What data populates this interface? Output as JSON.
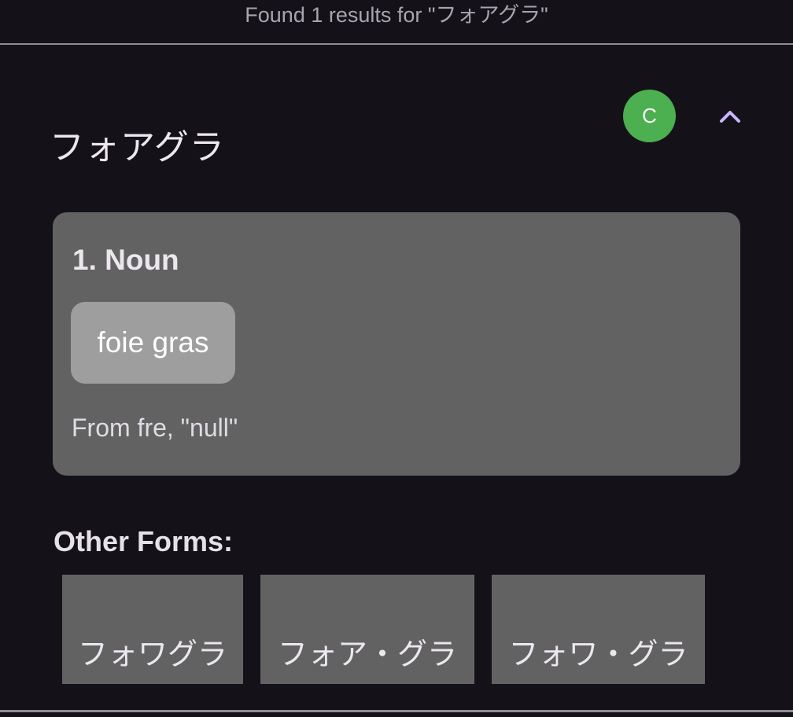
{
  "header": {
    "results_text": "Found 1 results for \"フォアグラ\""
  },
  "entry": {
    "title": "フォアグラ",
    "avatar_letter": "C",
    "collapse_icon": "chevron-up-icon",
    "senses": [
      {
        "heading": "1. Noun",
        "glosses": [
          "foie gras"
        ],
        "source_note": "From fre, \"null\""
      }
    ],
    "other_forms_label": "Other Forms:",
    "other_forms": [
      "フォワグラ",
      "フォア・グラ",
      "フォワ・グラ"
    ]
  },
  "colors": {
    "background": "#141218",
    "avatar": "#4caf50",
    "chevron": "#c9b6ff",
    "card": "#626262",
    "chip": "#9e9e9e"
  }
}
